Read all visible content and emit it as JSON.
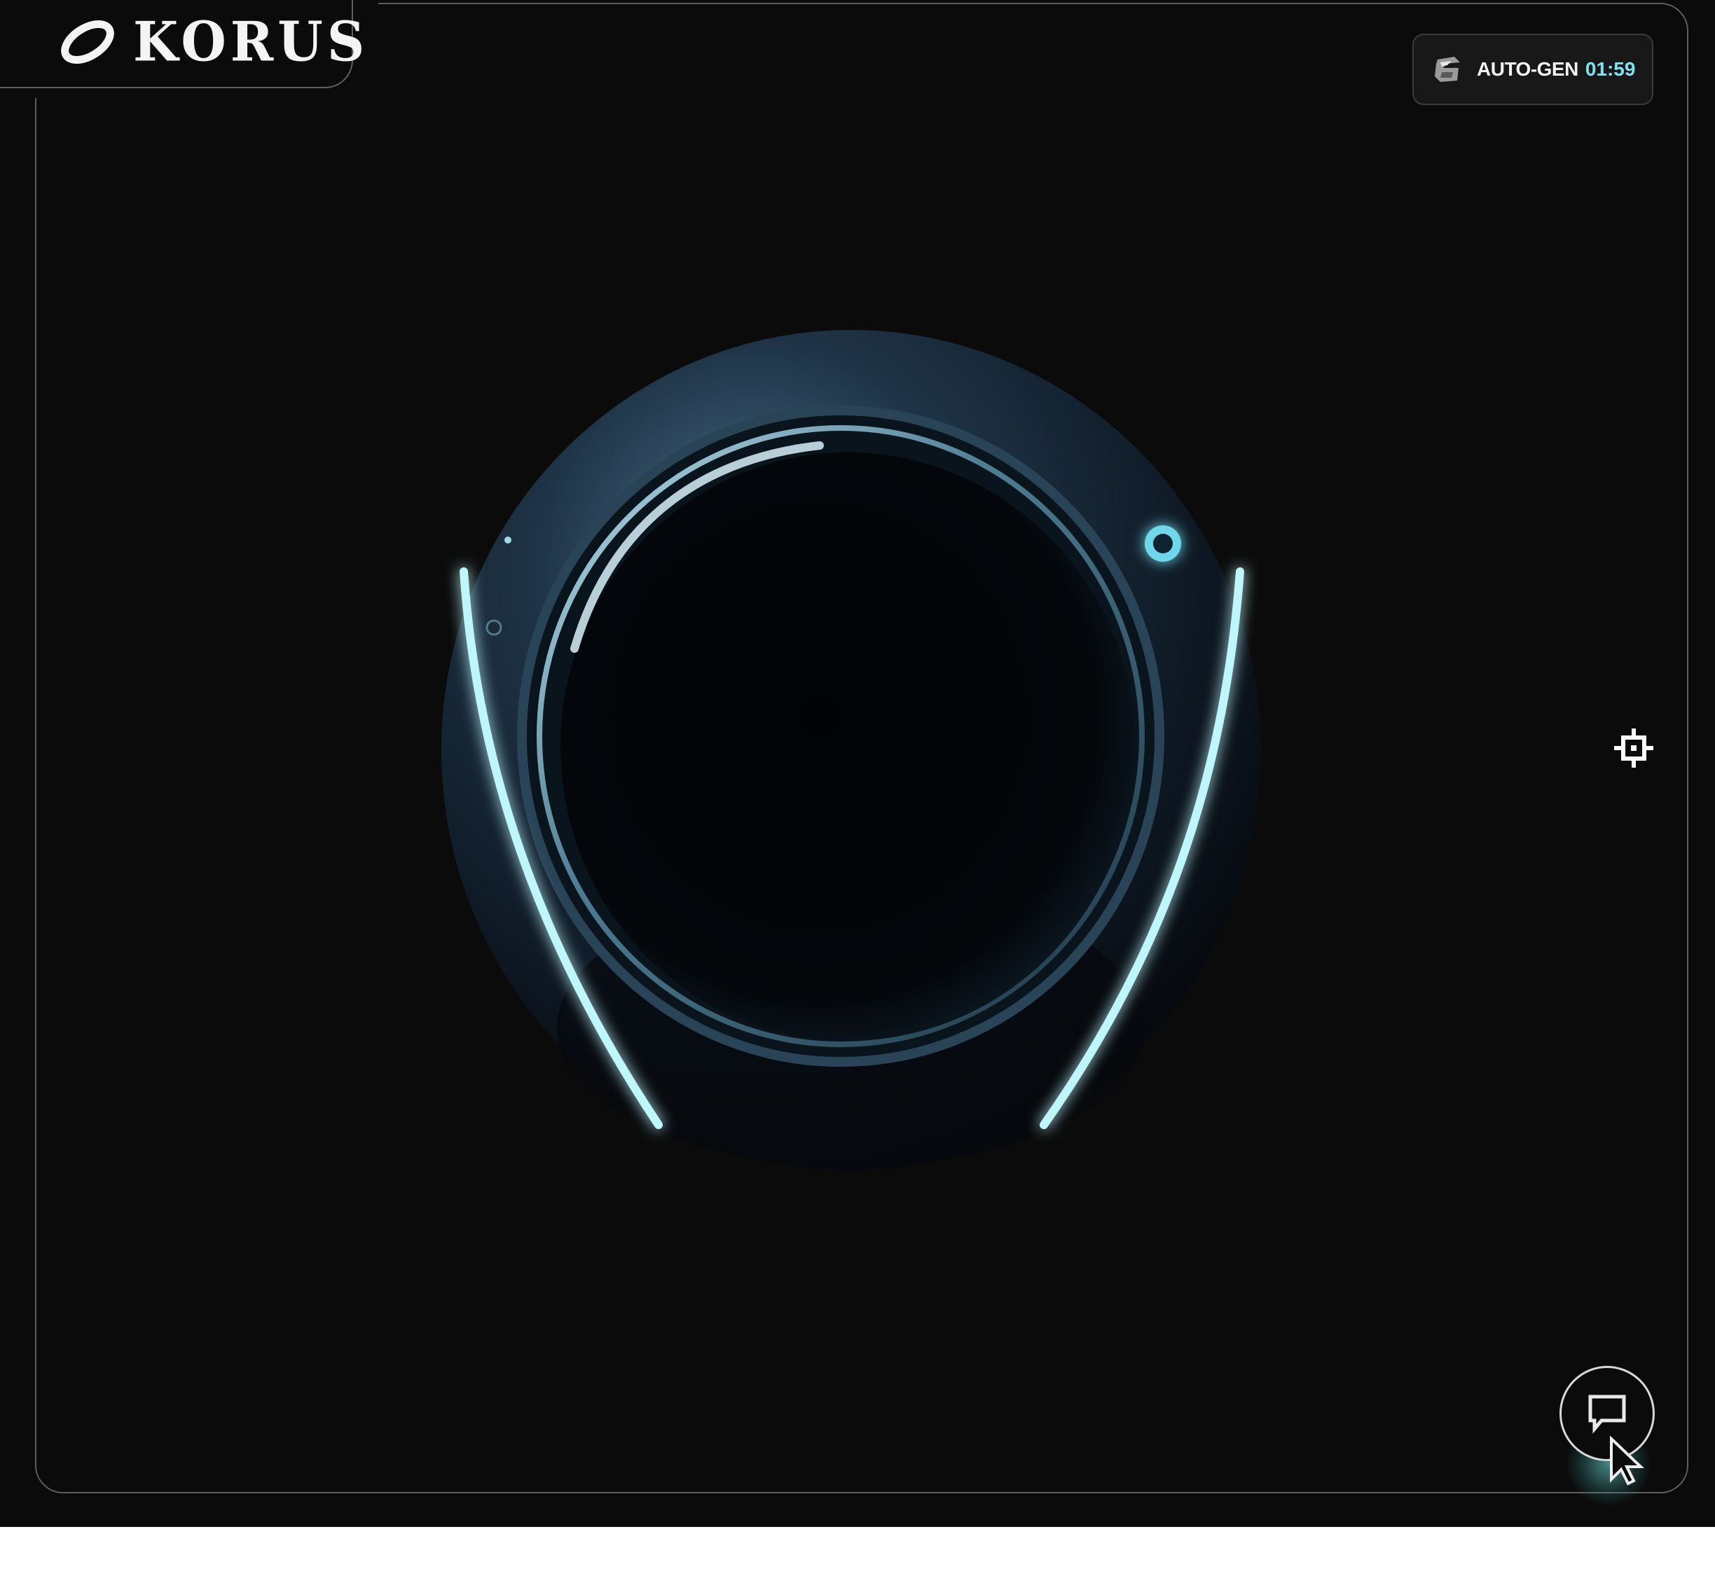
{
  "brand": {
    "name": "KORUS"
  },
  "autogen": {
    "label": "AUTO-GEN",
    "timer": "01:59",
    "timer_color": "#7fe3ee"
  },
  "controls": {
    "recenter_icon": "crosshair-icon",
    "chat_icon": "chat-bubble-icon"
  },
  "colors": {
    "background": "#0b0b0b",
    "frame_border": "#5e5e5e",
    "accent_glow": "#8ff0f4"
  }
}
